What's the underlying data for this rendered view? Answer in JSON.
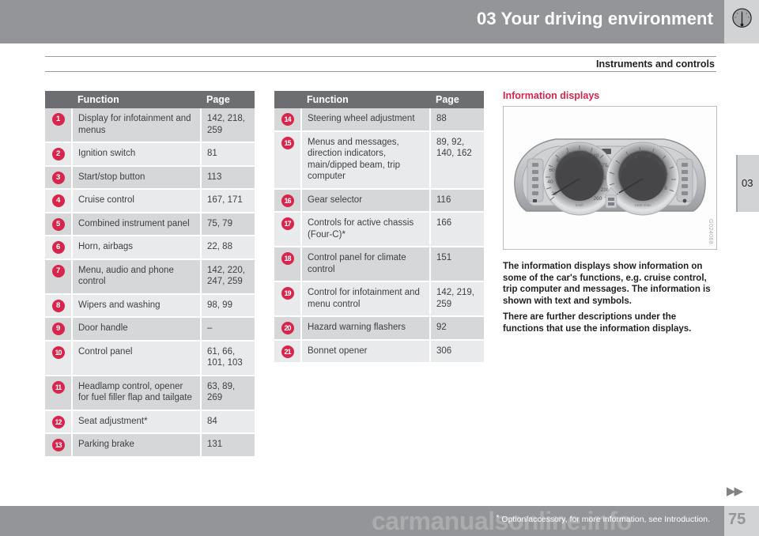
{
  "header": {
    "chapter_title": "03 Your driving environment",
    "section_caption": "Instruments and controls",
    "gauge_icon": "gauge-icon"
  },
  "chapter_tab": {
    "label": "03"
  },
  "tables": {
    "column_headers": {
      "function": "Function",
      "page": "Page"
    },
    "left": [
      {
        "num": "1",
        "function": "Display for infotainment and menus",
        "page": "142, 218, 259"
      },
      {
        "num": "2",
        "function": "Ignition switch",
        "page": "81"
      },
      {
        "num": "3",
        "function": "Start/stop button",
        "page": "113"
      },
      {
        "num": "4",
        "function": "Cruise control",
        "page": "167, 171"
      },
      {
        "num": "5",
        "function": "Combined instrument panel",
        "page": "75, 79"
      },
      {
        "num": "6",
        "function": "Horn, airbags",
        "page": "22, 88"
      },
      {
        "num": "7",
        "function": "Menu, audio and phone control",
        "page": "142, 220, 247, 259"
      },
      {
        "num": "8",
        "function": "Wipers and washing",
        "page": "98, 99"
      },
      {
        "num": "9",
        "function": "Door handle",
        "page": "–"
      },
      {
        "num": "10",
        "function": "Control panel",
        "page": "61, 66, 101, 103"
      },
      {
        "num": "11",
        "function": "Headlamp control, opener for fuel filler flap and tailgate",
        "page": "63, 89, 269"
      },
      {
        "num": "12",
        "function": "Seat adjustment*",
        "page": "84"
      },
      {
        "num": "13",
        "function": "Parking brake",
        "page": "131"
      }
    ],
    "right": [
      {
        "num": "14",
        "function": "Steering wheel adjustment",
        "page": "88"
      },
      {
        "num": "15",
        "function": "Menus and messages, direction indicators, main/dipped beam, trip computer",
        "page": "89, 92, 140, 162"
      },
      {
        "num": "16",
        "function": "Gear selector",
        "page": "116"
      },
      {
        "num": "17",
        "function": "Controls for active chassis (Four-C)*",
        "page": "166"
      },
      {
        "num": "18",
        "function": "Control panel for climate control",
        "page": "151"
      },
      {
        "num": "19",
        "function": "Control for infotainment and menu control",
        "page": "142, 219, 259"
      },
      {
        "num": "20",
        "function": "Hazard warning flashers",
        "page": "92"
      },
      {
        "num": "21",
        "function": "Bonnet opener",
        "page": "306"
      }
    ]
  },
  "side_section": {
    "heading": "Information displays",
    "figure_id": "G024068",
    "figure_alt": "combined-instrument-panel-illustration",
    "paragraph_1": "The information displays show information on some of the car's functions, e.g. cruise control, trip computer and messages. The information is shown with text and symbols.",
    "paragraph_2": "There are further descriptions under the functions that use the information displays.",
    "speedometer_ticks": [
      "20",
      "40",
      "60",
      "80",
      "100",
      "120",
      "140",
      "170",
      "200",
      "230",
      "260"
    ],
    "speedometer_unit": "km/h",
    "tachometer_ticks": [
      "1",
      "2",
      "3",
      "4",
      "5",
      "6",
      "7",
      "8"
    ],
    "tachometer_unit": "1000 r/min"
  },
  "footer": {
    "note": "Option/accessory, for more information, see Introduction.",
    "asterisk": "*",
    "page_number": "75",
    "next_arrows": "▶▶",
    "watermark": "carmanualsonline.info"
  },
  "colors": {
    "brand_red": "#d8254c",
    "bar_grey": "#939598",
    "header_grey": "#6d6e71",
    "row_dark": "#d6d7d9",
    "row_light": "#e9eaeb",
    "tab_grey": "#d2d3d5"
  }
}
